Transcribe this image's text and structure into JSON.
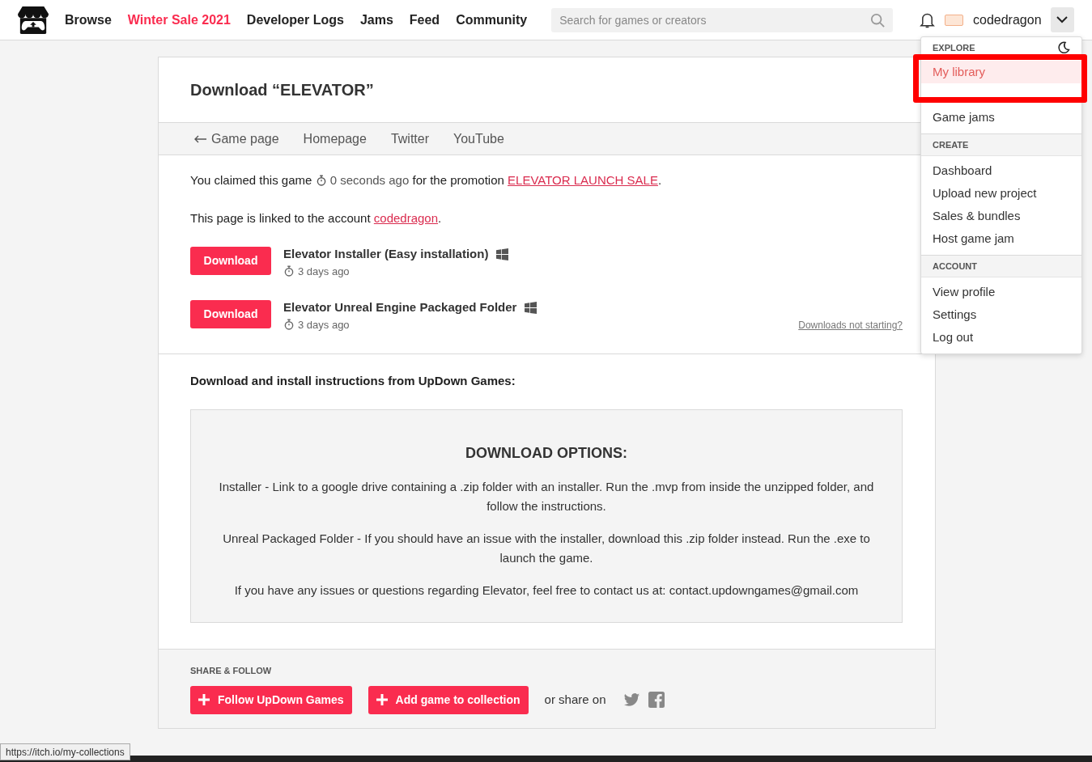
{
  "header": {
    "nav": [
      {
        "label": "Browse",
        "highlight": false
      },
      {
        "label": "Winter Sale 2021",
        "highlight": true
      },
      {
        "label": "Developer Logs",
        "highlight": false
      },
      {
        "label": "Jams",
        "highlight": false
      },
      {
        "label": "Feed",
        "highlight": false
      },
      {
        "label": "Community",
        "highlight": false
      }
    ],
    "search": {
      "placeholder": "Search for games or creators"
    },
    "username": "codedragon",
    "menu_open": true
  },
  "page": {
    "title_prefix": "Download ",
    "title": "“ELEVATOR”",
    "tabs": [
      {
        "label": "Game page",
        "back": true
      },
      {
        "label": "Homepage",
        "back": false
      },
      {
        "label": "Twitter",
        "back": false
      },
      {
        "label": "YouTube",
        "back": false
      }
    ],
    "claim": {
      "before": "You claimed this game",
      "time": "0 seconds ago",
      "middle": "for the promotion",
      "link": "ELEVATOR LAUNCH SALE",
      "after": "."
    },
    "account": {
      "before": "This page is linked to the account",
      "link": "codedragon",
      "after": "."
    },
    "uploads": [
      {
        "button": "Download",
        "name": "Elevator Installer (Easy installation)",
        "time": "3 days ago"
      },
      {
        "button": "Download",
        "name": "Elevator Unreal Engine Packaged Folder",
        "time": "3 days ago"
      }
    ],
    "not_starting": "Downloads not starting?",
    "instructions_title": "Download and install instructions from UpDown Games:",
    "box": {
      "heading": "DOWNLOAD OPTIONS:",
      "paragraphs": [
        "Installer - Link to a google drive containing a .zip folder with an installer. Run the .mvp from inside the unzipped folder, and follow the instructions.",
        "Unreal Packaged Folder - If you should have an issue with the installer, download this .zip folder instead. Run the .exe to launch the game.",
        "If you have any issues or questions regarding Elevator, feel free to contact us at: contact.updowngames@gmail.com"
      ]
    },
    "share": {
      "label": "SHARE & FOLLOW",
      "buttons": [
        "Follow UpDown Games",
        "Add game to collection"
      ],
      "or_share": "or share on"
    }
  },
  "dropdown": {
    "sections": [
      {
        "title": "EXPLORE",
        "items": [
          {
            "label": "My library",
            "selected": true
          },
          {
            "label": "Game jams",
            "selected": false
          }
        ]
      },
      {
        "title": "CREATE",
        "items": [
          {
            "label": "Dashboard",
            "selected": false
          },
          {
            "label": "Upload new project",
            "selected": false
          },
          {
            "label": "Sales & bundles",
            "selected": false
          },
          {
            "label": "Host game jam",
            "selected": false
          }
        ]
      },
      {
        "title": "ACCOUNT",
        "items": [
          {
            "label": "View profile",
            "selected": false
          },
          {
            "label": "Settings",
            "selected": false
          },
          {
            "label": "Log out",
            "selected": false
          }
        ]
      }
    ]
  },
  "status_url": "https://itch.io/my-collections"
}
